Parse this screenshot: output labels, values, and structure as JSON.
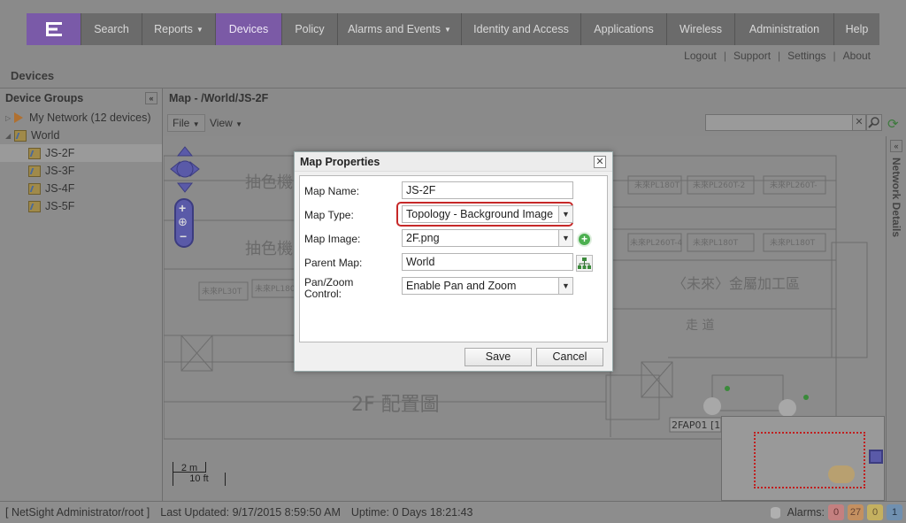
{
  "nav": {
    "items": [
      {
        "label": "Search",
        "caret": false,
        "active": false
      },
      {
        "label": "Reports",
        "caret": true,
        "active": false
      },
      {
        "label": "Devices",
        "caret": false,
        "active": true
      },
      {
        "label": "Policy",
        "caret": false,
        "active": false
      },
      {
        "label": "Alarms and Events",
        "caret": true,
        "active": false
      },
      {
        "label": "Identity and Access",
        "caret": false,
        "active": false
      },
      {
        "label": "Applications",
        "caret": false,
        "active": false
      },
      {
        "label": "Wireless",
        "caret": false,
        "active": false
      },
      {
        "label": "Administration",
        "caret": false,
        "active": false
      },
      {
        "label": "Help",
        "caret": false,
        "active": false
      }
    ]
  },
  "toplinks": {
    "logout": "Logout",
    "support": "Support",
    "settings": "Settings",
    "about": "About"
  },
  "page_title": "Devices",
  "left_panel": {
    "title": "Device Groups",
    "tree": [
      {
        "label": "My Network (12 devices)"
      },
      {
        "label": "World"
      },
      {
        "label": "JS-2F"
      },
      {
        "label": "JS-3F"
      },
      {
        "label": "JS-4F"
      },
      {
        "label": "JS-5F"
      }
    ]
  },
  "map": {
    "header": "Map - /World/JS-2F",
    "file_menu": "File",
    "view_menu": "View",
    "search_placeholder": "",
    "scale_top": "2 m",
    "scale_bottom": "10 ft",
    "right_panel_title": "Network Details"
  },
  "dialog": {
    "title": "Map Properties",
    "fields": {
      "map_name_label": "Map Name:",
      "map_name_value": "JS-2F",
      "map_type_label": "Map Type:",
      "map_type_value": "Topology - Background Image",
      "map_image_label": "Map Image:",
      "map_image_value": "2F.png",
      "parent_map_label": "Parent Map:",
      "parent_map_value": "World",
      "pan_zoom_label_1": "Pan/Zoom",
      "pan_zoom_label_2": "Control:",
      "pan_zoom_value": "Enable Pan and Zoom"
    },
    "save": "Save",
    "cancel": "Cancel"
  },
  "statusbar": {
    "user": "[ NetSight Administrator/root ]",
    "last_updated": "Last Updated: 9/17/2015 8:59:50 AM",
    "uptime": "Uptime: 0 Days 18:21:43",
    "alarms_label": "Alarms:",
    "alarm_counts": [
      {
        "value": "0",
        "color": "#c48080"
      },
      {
        "value": "27",
        "color": "#c49060"
      },
      {
        "value": "0",
        "color": "#c4b060"
      },
      {
        "value": "1",
        "color": "#7090b0"
      }
    ]
  },
  "floorplan": {
    "big_label": "2F 配置圖",
    "area_label": "〈未來〉金屬加工區",
    "left_label": "抽色機",
    "corridor": "走 道",
    "device_label": "2FAP01 [1"
  }
}
